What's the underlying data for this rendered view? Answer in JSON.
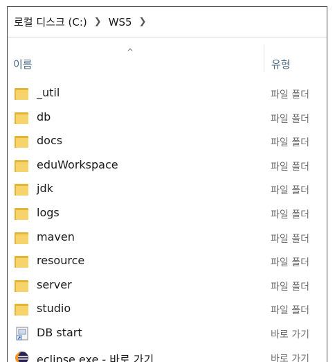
{
  "breadcrumb": {
    "drive": "로컬 디스크 (C:)",
    "folder": "WS5"
  },
  "header": {
    "name_col": "이름",
    "type_col": "유형",
    "sort_caret": "^"
  },
  "rows": [
    {
      "name": "_util",
      "type": "파일 폴더",
      "icon": "folder-icon"
    },
    {
      "name": "db",
      "type": "파일 폴더",
      "icon": "folder-icon"
    },
    {
      "name": "docs",
      "type": "파일 폴더",
      "icon": "folder-icon"
    },
    {
      "name": "eduWorkspace",
      "type": "파일 폴더",
      "icon": "folder-icon"
    },
    {
      "name": "jdk",
      "type": "파일 폴더",
      "icon": "folder-icon"
    },
    {
      "name": "logs",
      "type": "파일 폴더",
      "icon": "folder-icon"
    },
    {
      "name": "maven",
      "type": "파일 폴더",
      "icon": "folder-icon"
    },
    {
      "name": "resource",
      "type": "파일 폴더",
      "icon": "folder-icon"
    },
    {
      "name": "server",
      "type": "파일 폴더",
      "icon": "folder-icon"
    },
    {
      "name": "studio",
      "type": "파일 폴더",
      "icon": "folder-icon"
    },
    {
      "name": "DB start",
      "type": "바로 가기",
      "icon": "shortcut-icon"
    },
    {
      "name": "eclipse.exe - 바로 가기",
      "type": "바로 가기",
      "icon": "eclipse-icon"
    }
  ]
}
